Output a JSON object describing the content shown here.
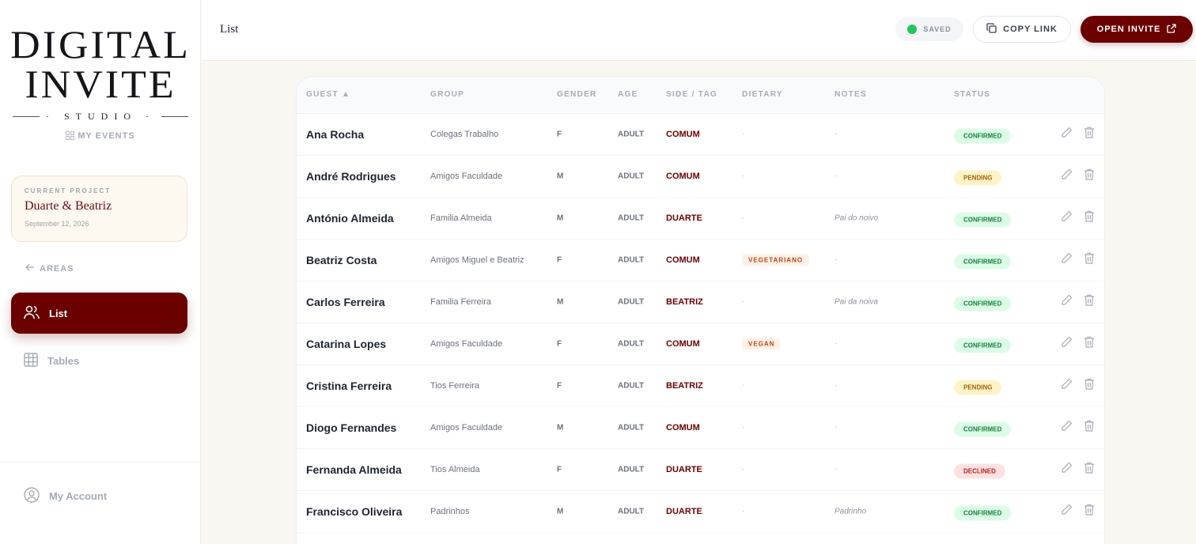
{
  "sidebar": {
    "logo": {
      "line1": "DIGITAL",
      "line2": "INVITE",
      "line3": "· STUDIO ·"
    },
    "my_events": "MY EVENTS",
    "project": {
      "caption": "CURRENT PROJECT",
      "name": "Duarte & Beatriz",
      "date": "September 12, 2026"
    },
    "areas": "AREAS",
    "nav": [
      {
        "label": "List",
        "icon": "users-icon"
      },
      {
        "label": "Tables",
        "icon": "grid-icon"
      }
    ],
    "account": "My Account"
  },
  "header": {
    "title": "List",
    "saved": "SAVED",
    "copy_link": "COPY LINK",
    "open_invite": "OPEN INVITE"
  },
  "colors": {
    "accent": "#6a0000",
    "saved_dot": "#22c55e"
  },
  "table": {
    "columns": [
      "GUEST ▲",
      "GROUP",
      "GENDER",
      "AGE",
      "SIDE / TAG",
      "DIETARY",
      "NOTES",
      "STATUS"
    ],
    "rows": [
      {
        "name": "Ana Rocha",
        "group": "Colegas Trabalho",
        "gender": "F",
        "age": "ADULT",
        "side": "COMUM",
        "dietary": "-",
        "notes": "-",
        "status": "CONFIRMED"
      },
      {
        "name": "André Rodrigues",
        "group": "Amigos Faculdade",
        "gender": "M",
        "age": "ADULT",
        "side": "COMUM",
        "dietary": "-",
        "notes": "-",
        "status": "PENDING"
      },
      {
        "name": "António Almeida",
        "group": "Familia Almeida",
        "gender": "M",
        "age": "ADULT",
        "side": "DUARTE",
        "dietary": "-",
        "notes": "Pai do noivo",
        "status": "CONFIRMED"
      },
      {
        "name": "Beatriz Costa",
        "group": "Amigos Miguel e Beatriz",
        "gender": "F",
        "age": "ADULT",
        "side": "COMUM",
        "dietary": "VEGETARIANO",
        "notes": "-",
        "status": "CONFIRMED"
      },
      {
        "name": "Carlos Ferreira",
        "group": "Familia Ferreira",
        "gender": "M",
        "age": "ADULT",
        "side": "BEATRIZ",
        "dietary": "-",
        "notes": "Pai da noiva",
        "status": "CONFIRMED"
      },
      {
        "name": "Catarina Lopes",
        "group": "Amigos Faculdade",
        "gender": "F",
        "age": "ADULT",
        "side": "COMUM",
        "dietary": "VEGAN",
        "notes": "-",
        "status": "CONFIRMED"
      },
      {
        "name": "Cristina Ferreira",
        "group": "Tios Ferreira",
        "gender": "F",
        "age": "ADULT",
        "side": "BEATRIZ",
        "dietary": "-",
        "notes": "-",
        "status": "PENDING"
      },
      {
        "name": "Diogo Fernandes",
        "group": "Amigos Faculdade",
        "gender": "M",
        "age": "ADULT",
        "side": "COMUM",
        "dietary": "-",
        "notes": "-",
        "status": "CONFIRMED"
      },
      {
        "name": "Fernanda Almeida",
        "group": "Tios Almeida",
        "gender": "F",
        "age": "ADULT",
        "side": "DUARTE",
        "dietary": "-",
        "notes": "-",
        "status": "DECLINED"
      },
      {
        "name": "Francisco Oliveira",
        "group": "Padrinhos",
        "gender": "M",
        "age": "ADULT",
        "side": "DUARTE",
        "dietary": "-",
        "notes": "Padrinho",
        "status": "CONFIRMED"
      }
    ]
  }
}
